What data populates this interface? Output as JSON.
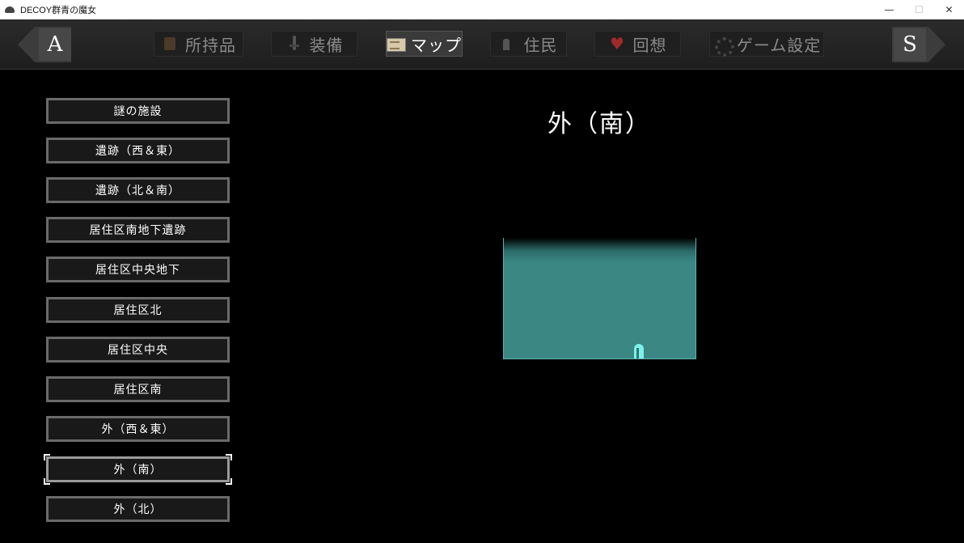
{
  "window": {
    "title": "DECOY群青の魔女",
    "controls": {
      "minimize": "—",
      "maximize": "☐",
      "close": "✕"
    }
  },
  "nav": {
    "prev_key": "A",
    "next_key": "S"
  },
  "tabs": [
    {
      "label": "所持品",
      "icon": "bag-icon",
      "active": false
    },
    {
      "label": "装備",
      "icon": "sword-icon",
      "active": false
    },
    {
      "label": "マップ",
      "icon": "map-icon",
      "active": true
    },
    {
      "label": "住民",
      "icon": "person-icon",
      "active": false
    },
    {
      "label": "回想",
      "icon": "heart-icon",
      "active": false
    },
    {
      "label": "ゲーム設定",
      "icon": "gear-icon",
      "active": false
    }
  ],
  "locations": [
    "謎の施設",
    "遺跡（西＆東）",
    "遺跡（北＆南）",
    "居住区南地下遺跡",
    "居住区中央地下",
    "居住区北",
    "居住区中央",
    "居住区南",
    "外（西＆東）",
    "外（南）",
    "外（北）"
  ],
  "selected_location": "外（南）",
  "map": {
    "title": "外（南）",
    "colors": {
      "area": "#3a8784",
      "border": "#5fb0ab",
      "player": "#7ff0e8"
    }
  }
}
